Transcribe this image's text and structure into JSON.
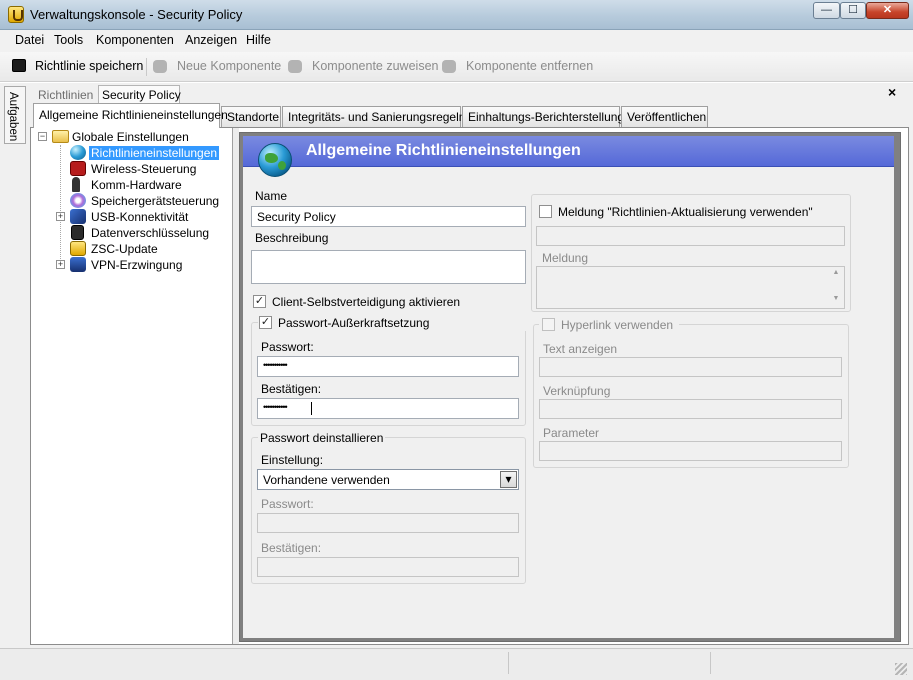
{
  "window": {
    "title": "Verwaltungskonsole - Security Policy",
    "min_glyph": "—",
    "max_glyph": "☐",
    "close_glyph": "✕"
  },
  "menu": [
    "Datei",
    "Tools",
    "Komponenten",
    "Anzeigen",
    "Hilfe"
  ],
  "toolbar": {
    "save": "Richtlinie speichern",
    "new_component": "Neue Komponente",
    "assign_component": "Komponente zuweisen",
    "remove_component": "Komponente entfernen"
  },
  "sidepanel": {
    "tasks_label": "Aufgaben"
  },
  "breadcrumb": {
    "root": "Richtlinien",
    "current": "Security Policy"
  },
  "doc_close_glyph": "×",
  "tabs": [
    "Allgemeine Richtlinieneinstellungen",
    "Standorte",
    "Integritäts- und Sanierungsregeln",
    "Einhaltungs-Berichterstellung",
    "Veröffentlichen"
  ],
  "tree": {
    "root": "Globale Einstellungen",
    "items": [
      "Richtlinieneinstellungen",
      "Wireless-Steuerung",
      "Komm-Hardware",
      "Speichergerätsteuerung",
      "USB-Konnektivität",
      "Datenverschlüsselung",
      "ZSC-Update",
      "VPN-Erzwingung"
    ],
    "selected": "Richtlinieneinstellungen"
  },
  "panel": {
    "title": "Allgemeine Richtlinieneinstellungen",
    "name_label": "Name",
    "name_value": "Security Policy",
    "description_label": "Beschreibung",
    "description_value": "",
    "client_self_defense": {
      "label": "Client-Selbstverteidigung aktivieren",
      "checked": true
    },
    "password_override": {
      "label": "Passwort-Außerkraftsetzung",
      "checked": true,
      "password_label": "Passwort:",
      "password_value": "•••••••••••",
      "confirm_label": "Bestätigen:",
      "confirm_value": "•••••••••••"
    },
    "uninstall_password": {
      "group_label": "Passwort deinstallieren",
      "setting_label": "Einstellung:",
      "setting_value": "Vorhandene verwenden",
      "password_label": "Passwort:",
      "confirm_label": "Bestätigen:"
    },
    "update_message": {
      "label": "Meldung \"Richtlinien-Aktualisierung verwenden\"",
      "checked": false,
      "message_label": "Meldung",
      "hyperlink_label": "Hyperlink verwenden",
      "hyperlink_checked": false,
      "display_text_label": "Text anzeigen",
      "link_label": "Verknüpfung",
      "parameter_label": "Parameter"
    }
  },
  "check_glyph": "✓",
  "dropdown_glyph": "▾",
  "expander_minus": "−",
  "expander_plus": "+",
  "scroll_up_glyph": "▲",
  "scroll_down_glyph": "▼"
}
